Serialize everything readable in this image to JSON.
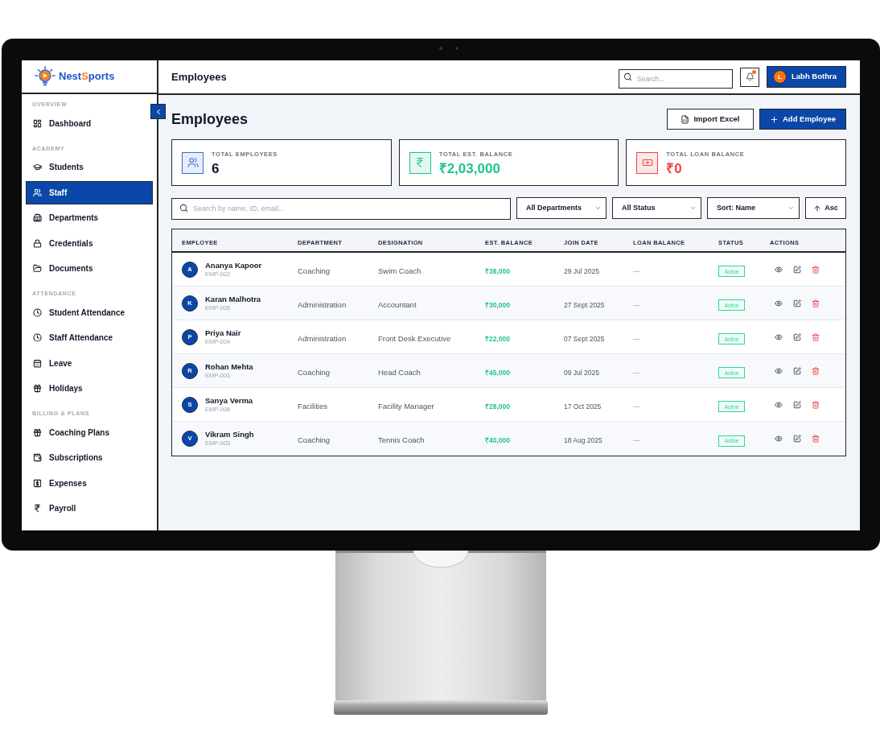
{
  "sidebar": {
    "brand": {
      "name_parts": [
        {
          "text": "Nest",
          "accent": false
        },
        {
          "text": "S",
          "accent": true
        },
        {
          "text": "ports",
          "accent": false
        }
      ]
    },
    "sections": [
      {
        "label": "OVERVIEW",
        "items": [
          {
            "label": "Dashboard",
            "selected": false
          }
        ]
      },
      {
        "label": "ACADEMY",
        "items": [
          {
            "label": "Students",
            "selected": false
          },
          {
            "label": "Staff",
            "selected": true
          },
          {
            "label": "Departments",
            "selected": false
          },
          {
            "label": "Credentials",
            "selected": false
          },
          {
            "label": "Documents",
            "selected": false
          }
        ]
      },
      {
        "label": "ATTENDANCE",
        "items": [
          {
            "label": "Student Attendance",
            "selected": false
          },
          {
            "label": "Staff Attendance",
            "selected": false
          },
          {
            "label": "Leave",
            "selected": false
          },
          {
            "label": "Holidays",
            "selected": false
          }
        ]
      },
      {
        "label": "BILLING & PLANS",
        "items": [
          {
            "label": "Coaching Plans",
            "selected": false
          },
          {
            "label": "Subscriptions",
            "selected": false
          },
          {
            "label": "Expenses",
            "selected": false
          },
          {
            "label": "Payroll",
            "selected": false
          }
        ]
      }
    ]
  },
  "header": {
    "title": "Employees",
    "search": {
      "placeholder": "Search..."
    },
    "notifications": {
      "unread": true
    },
    "user": {
      "initial": "L",
      "name": "Labh Bothra"
    }
  },
  "page": {
    "title": "Employees",
    "actions": [
      {
        "label": "Import Excel",
        "kind": "secondary"
      },
      {
        "label": "Add Employee",
        "kind": "primary"
      }
    ]
  },
  "stats": [
    {
      "label": "TOTAL EMPLOYEES",
      "value": "6",
      "kind": "count",
      "color": "#3b6fd1"
    },
    {
      "label": "TOTAL EST. BALANCE",
      "value": "₹2,03,000",
      "kind": "money",
      "color": "#1fc48a"
    },
    {
      "label": "TOTAL LOAN BALANCE",
      "value": "₹0",
      "kind": "money",
      "color": "#ef4444"
    }
  ],
  "filters": {
    "search": {
      "placeholder": "Search by name, ID, email..."
    },
    "selects": [
      {
        "value": "All Departments"
      },
      {
        "value": "All Status"
      },
      {
        "value": "Sort: Name"
      }
    ],
    "order": {
      "label": "Asc"
    }
  },
  "table": {
    "columns": [
      "EMPLOYEE",
      "DEPARTMENT",
      "DESIGNATION",
      "EST. BALANCE",
      "JOIN DATE",
      "LOAN BALANCE",
      "STATUS",
      "ACTIONS"
    ],
    "rows": [
      {
        "initial": "A",
        "name": "Ananya Kapoor",
        "id": "EMP-002",
        "department": "Coaching",
        "designation": "Swim Coach",
        "est_balance": "₹38,000",
        "join_date": "29 Jul 2025",
        "loan_balance": "—",
        "status": "Active"
      },
      {
        "initial": "K",
        "name": "Karan Malhotra",
        "id": "EMP-005",
        "department": "Administration",
        "designation": "Accountant",
        "est_balance": "₹30,000",
        "join_date": "27 Sept 2025",
        "loan_balance": "—",
        "status": "Active"
      },
      {
        "initial": "P",
        "name": "Priya Nair",
        "id": "EMP-004",
        "department": "Administration",
        "designation": "Front Desk Executive",
        "est_balance": "₹22,000",
        "join_date": "07 Sept 2025",
        "loan_balance": "—",
        "status": "Active"
      },
      {
        "initial": "R",
        "name": "Rohan Mehta",
        "id": "EMP-001",
        "department": "Coaching",
        "designation": "Head Coach",
        "est_balance": "₹45,000",
        "join_date": "09 Jul 2025",
        "loan_balance": "—",
        "status": "Active"
      },
      {
        "initial": "S",
        "name": "Sanya Verma",
        "id": "EMP-006",
        "department": "Facilities",
        "designation": "Facility Manager",
        "est_balance": "₹28,000",
        "join_date": "17 Oct 2025",
        "loan_balance": "—",
        "status": "Active"
      },
      {
        "initial": "V",
        "name": "Vikram Singh",
        "id": "EMP-003",
        "department": "Coaching",
        "designation": "Tennis Coach",
        "est_balance": "₹40,000",
        "join_date": "18 Aug 2025",
        "loan_balance": "—",
        "status": "Active"
      }
    ]
  }
}
